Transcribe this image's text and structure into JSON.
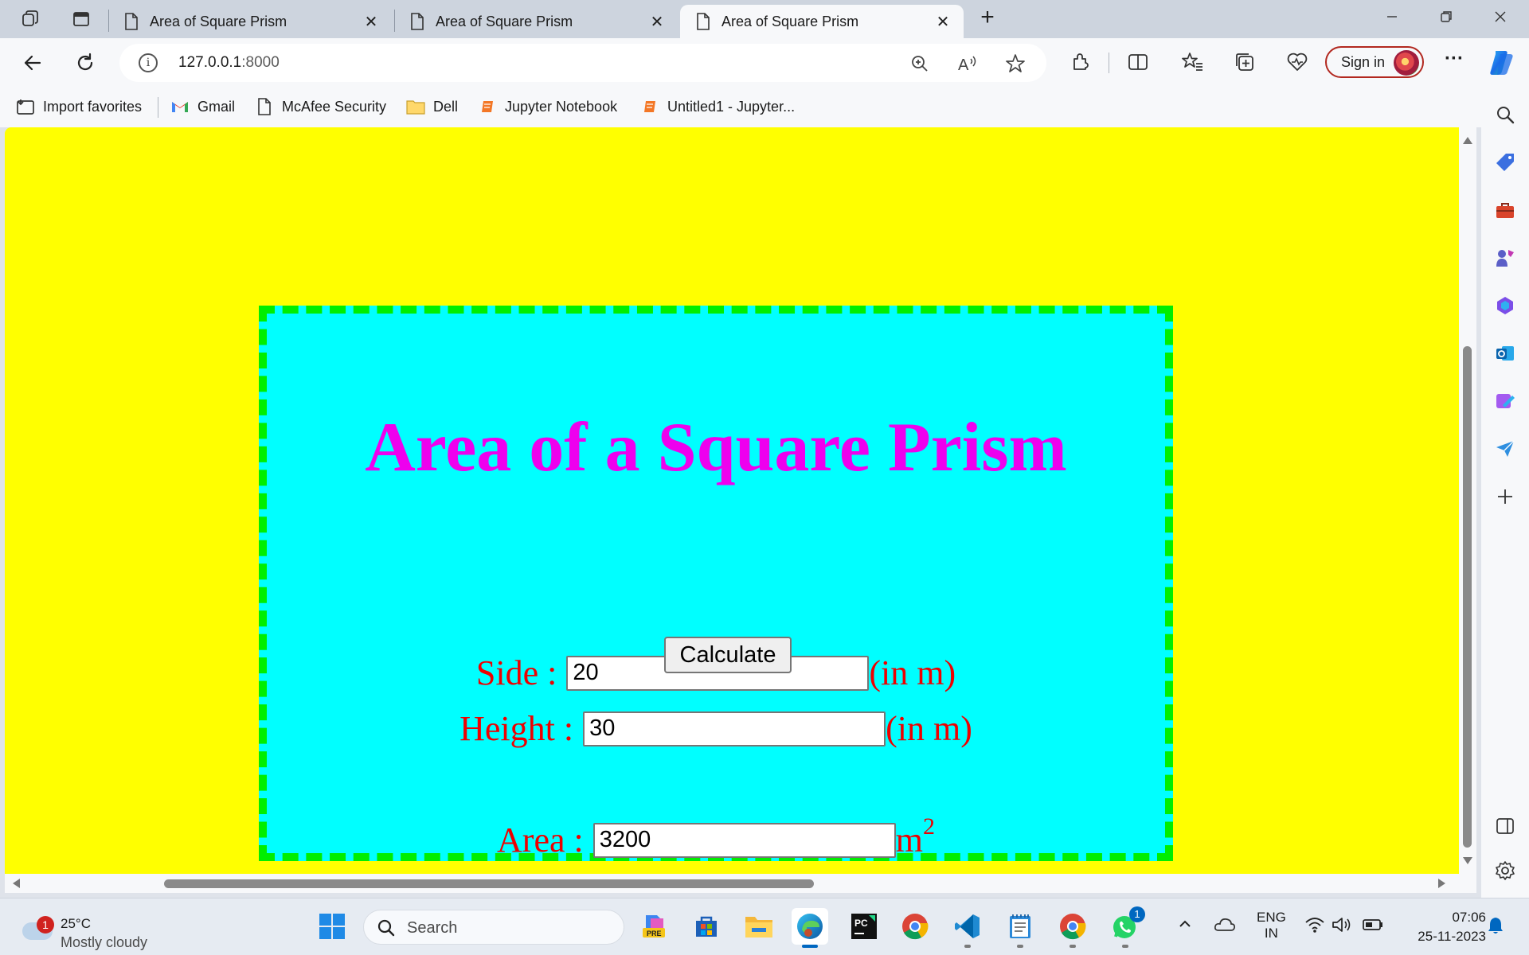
{
  "browser": {
    "tabs": [
      {
        "label": "Area of Square Prism",
        "active": false
      },
      {
        "label": "Area of Square Prism",
        "active": false
      },
      {
        "label": "Area of Square Prism",
        "active": true
      }
    ],
    "tab_close": "✕",
    "new_tab": "+",
    "window_controls": {
      "minimize": "—",
      "restore": "❐",
      "close": "✕"
    },
    "address": {
      "host": "127.0.0.1",
      "port": ":8000"
    },
    "sign_in_label": "Sign in",
    "more_label": "···",
    "bookmarks": [
      {
        "label": "Import favorites",
        "icon": "import-icon"
      },
      {
        "label": "Gmail",
        "icon": "gmail-icon"
      },
      {
        "label": "McAfee Security",
        "icon": "page-icon"
      },
      {
        "label": "Dell",
        "icon": "folder-icon"
      },
      {
        "label": "Jupyter Notebook",
        "icon": "jupyter-icon"
      },
      {
        "label": "Untitled1 - Jupyter...",
        "icon": "jupyter-icon"
      }
    ]
  },
  "page": {
    "title": "Area of a Square Prism",
    "side_label": "Side : ",
    "side_value": "20",
    "side_unit": "(in m)",
    "height_label": "Height : ",
    "height_value": "30",
    "height_unit": "(in m)",
    "calculate_label": "Calculate",
    "area_label": "Area : ",
    "area_value": "3200",
    "area_unit": "m",
    "area_unit_exp": "2",
    "colors": {
      "background": "#ffff00",
      "card": "#00ffff",
      "border": "#00ee00",
      "title": "#ee00ee",
      "labels": "#ee0000"
    }
  },
  "taskbar": {
    "weather": {
      "temp": "25°C",
      "condition": "Mostly cloudy",
      "badge": "1"
    },
    "search_label": "Search",
    "whatsapp_badge": "1",
    "language": {
      "line1": "ENG",
      "line2": "IN"
    },
    "clock": {
      "time": "07:06",
      "date": "25-11-2023"
    }
  }
}
